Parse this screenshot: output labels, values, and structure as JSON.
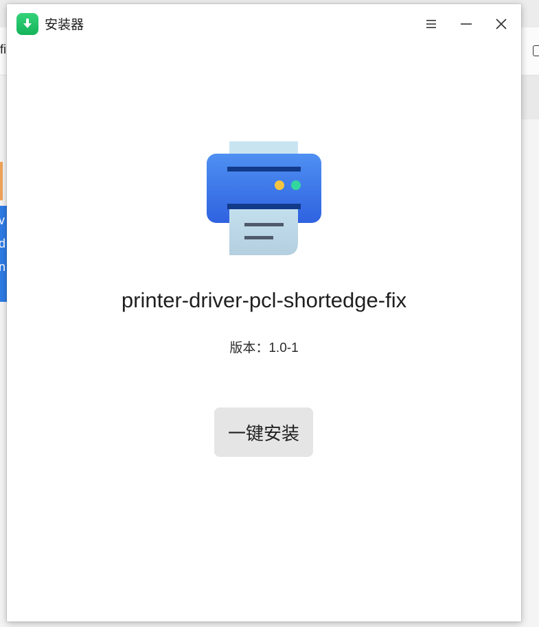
{
  "window": {
    "title": "安装器",
    "icon": "download-arrow-icon",
    "controls": [
      "menu-icon",
      "minimize-icon",
      "close-icon"
    ]
  },
  "package": {
    "name": "printer-driver-pcl-shortedge-fix",
    "version_label": "版本：",
    "version_value": "1.0-1",
    "icon": "printer-icon"
  },
  "actions": {
    "install_label": "一键安装"
  },
  "background": {
    "toolbar_text": "fi",
    "side_text": [
      "v",
      "d",
      "n"
    ]
  },
  "colors": {
    "app_icon_green": "#1cc063",
    "printer_blue": "#3b78ec",
    "printer_dark": "#123a8a",
    "paper": "#c9e4f1",
    "indicator_yellow": "#f5c542",
    "indicator_green": "#33d69f",
    "button_bg": "#e5e5e5"
  }
}
